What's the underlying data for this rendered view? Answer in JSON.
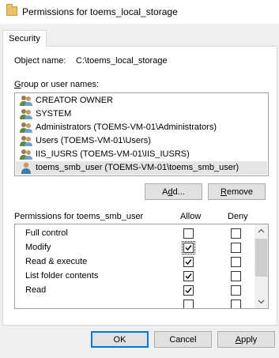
{
  "window": {
    "title": "Permissions for toems_local_storage",
    "tab": "Security"
  },
  "object": {
    "label": "Object name:",
    "value": "C:\\toems_local_storage"
  },
  "groups": {
    "label": "Group or user names:",
    "items": [
      {
        "name": "CREATOR OWNER",
        "icon": "group-icon",
        "selected": false
      },
      {
        "name": "SYSTEM",
        "icon": "group-icon",
        "selected": false
      },
      {
        "name": "Administrators (TOEMS-VM-01\\Administrators)",
        "icon": "group-icon",
        "selected": false
      },
      {
        "name": "Users (TOEMS-VM-01\\Users)",
        "icon": "group-icon",
        "selected": false
      },
      {
        "name": "IIS_IUSRS (TOEMS-VM-01\\IIS_IUSRS)",
        "icon": "group-icon",
        "selected": false
      },
      {
        "name": "toems_smb_user (TOEMS-VM-01\\toems_smb_user)",
        "icon": "user-icon",
        "selected": true
      }
    ],
    "add_button": "Add...",
    "remove_button": "Remove"
  },
  "permissions": {
    "label": "Permissions for toems_smb_user",
    "allow_header": "Allow",
    "deny_header": "Deny",
    "rows": [
      {
        "name": "Full control",
        "allow": false,
        "deny": false
      },
      {
        "name": "Modify",
        "allow": true,
        "deny": false
      },
      {
        "name": "Read & execute",
        "allow": true,
        "deny": false
      },
      {
        "name": "List folder contents",
        "allow": true,
        "deny": false
      },
      {
        "name": "Read",
        "allow": true,
        "deny": false
      }
    ]
  },
  "footer": {
    "ok": "OK",
    "cancel": "Cancel",
    "apply": "Apply"
  },
  "colors": {
    "selection": "#e5e5e5",
    "default_button_border": "#0078d7",
    "window_bg": "#f0f0f0"
  }
}
